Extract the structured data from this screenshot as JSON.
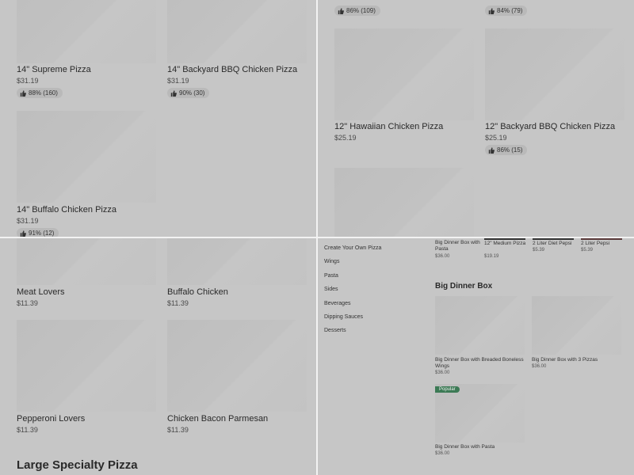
{
  "q1": {
    "cards": [
      {
        "name": "14\" Supreme Pizza",
        "price": "$31.19",
        "rating": "88% (160)"
      },
      {
        "name": "14\" Backyard BBQ Chicken Pizza",
        "price": "$31.19",
        "rating": "90% (30)"
      },
      {
        "name": "14\" Buffalo Chicken Pizza",
        "price": "$31.19",
        "rating": "91% (12)"
      }
    ]
  },
  "q2": {
    "top_ratings": [
      "86% (109)",
      "84% (79)"
    ],
    "cards": [
      {
        "name": "12\" Hawaiian Chicken Pizza",
        "price": "$25.19"
      },
      {
        "name": "12\" Backyard BBQ Chicken Pizza",
        "price": "$25.19",
        "rating": "86% (15)"
      }
    ]
  },
  "q3": {
    "cards": [
      {
        "name": "Meat Lovers",
        "price": "$11.39"
      },
      {
        "name": "Buffalo Chicken",
        "price": "$11.39"
      },
      {
        "name": "Pepperoni Lovers",
        "price": "$11.39"
      },
      {
        "name": "Chicken Bacon Parmesan",
        "price": "$11.39"
      }
    ],
    "section_title": "Large Specialty Pizza"
  },
  "q4": {
    "nav": [
      "Create Your Own Pizza",
      "Wings",
      "Pasta",
      "Sides",
      "Beverages",
      "Dipping Sauces",
      "Desserts"
    ],
    "carousel": [
      {
        "name": "Big Dinner Box with Pasta",
        "price": "$36.00"
      },
      {
        "name": "12\" Medium Pizza",
        "price": "$19.19"
      },
      {
        "name": "2 Liter Diet Pepsi",
        "price": "$5.39"
      },
      {
        "name": "2 Liter Pepsi",
        "price": "$5.39"
      }
    ],
    "section_title": "Big Dinner Box",
    "boxes": [
      {
        "name": "Big Dinner Box with Breaded Boneless Wings",
        "price": "$36.00"
      },
      {
        "name": "Big Dinner Box with 3 Pizzas",
        "price": "$36.00"
      },
      {
        "name": "Big Dinner Box with Pasta",
        "price": "$36.00",
        "badge": "Popular"
      }
    ]
  },
  "colors": {
    "badge": "#3c7a55",
    "divider": "#f2f2f2"
  }
}
